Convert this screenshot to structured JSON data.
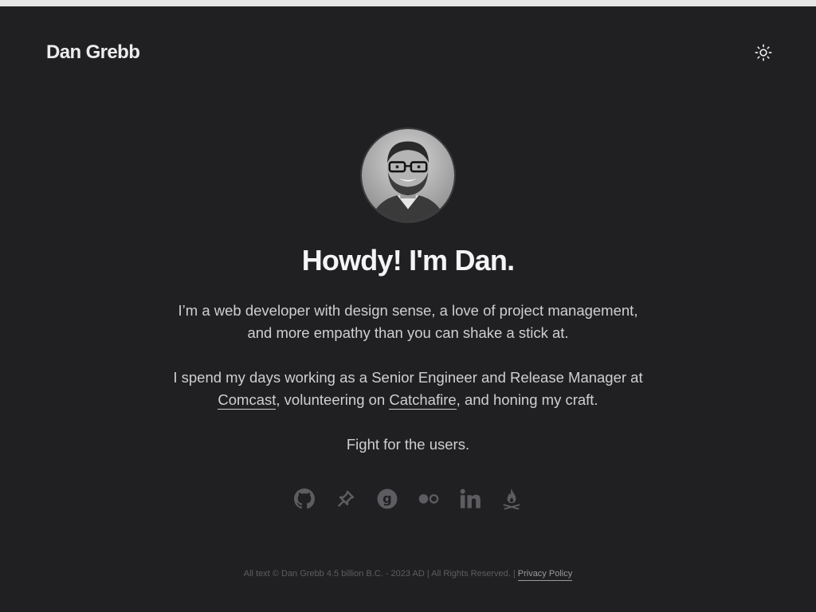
{
  "header": {
    "site_title": "Dan Grebb"
  },
  "hero": {
    "headline": "Howdy! I'm Dan.",
    "intro": "I’m a web developer with design sense, a love of project management, and more empathy than you can shake a stick at.",
    "work_prefix": "I spend my days working as a Senior Engineer and Release Manager at ",
    "work_link_comcast": "Comcast",
    "work_middle": ", volunteering on ",
    "work_link_catchafire": "Catchafire",
    "work_suffix": ", and honing my craft.",
    "tagline": "Fight for the users."
  },
  "socials": [
    {
      "icon": "github-icon"
    },
    {
      "icon": "pushpin-icon"
    },
    {
      "icon": "goodreads-icon"
    },
    {
      "icon": "flickr-icon"
    },
    {
      "icon": "linkedin-icon"
    },
    {
      "icon": "campfire-icon"
    }
  ],
  "footer": {
    "copyright": "All text © Dan Grebb 4.5 billion B.C. - 2023 AD | All Rights Reserved. | ",
    "privacy_link": "Privacy Policy"
  },
  "colors": {
    "background": "#202022",
    "text": "#cfcfd2",
    "muted_icon": "#5d5d61"
  }
}
